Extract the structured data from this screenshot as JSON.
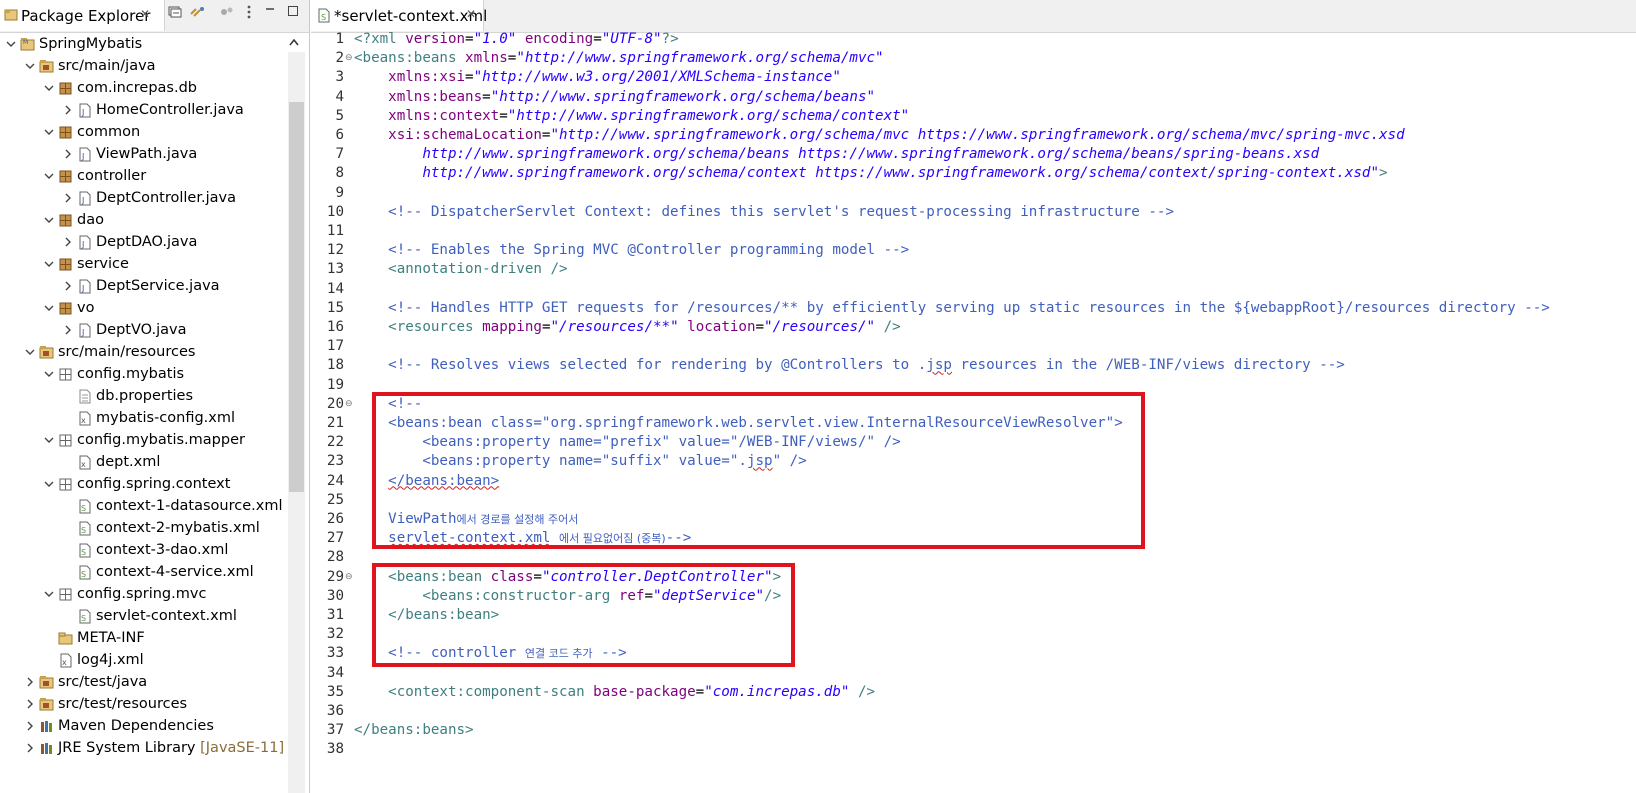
{
  "explorer": {
    "tab_title": "Package Explorer",
    "close_glyph": "✕",
    "tree": [
      {
        "label": "SpringMybatis",
        "indent": 0,
        "expanded": true,
        "icon": "project-icon",
        "deco": ""
      },
      {
        "label": "src/main/java",
        "indent": 1,
        "expanded": true,
        "icon": "source-folder-icon",
        "deco": ""
      },
      {
        "label": "com.increpas.db",
        "indent": 2,
        "expanded": true,
        "icon": "package-icon",
        "deco": ""
      },
      {
        "label": "HomeController.java",
        "indent": 3,
        "expanded": false,
        "icon": "java-file-icon",
        "deco": ""
      },
      {
        "label": "common",
        "indent": 2,
        "expanded": true,
        "icon": "package-icon",
        "deco": ""
      },
      {
        "label": "ViewPath.java",
        "indent": 3,
        "expanded": false,
        "icon": "java-file-icon",
        "deco": ""
      },
      {
        "label": "controller",
        "indent": 2,
        "expanded": true,
        "icon": "package-icon",
        "deco": ""
      },
      {
        "label": "DeptController.java",
        "indent": 3,
        "expanded": false,
        "icon": "java-file-icon",
        "deco": ""
      },
      {
        "label": "dao",
        "indent": 2,
        "expanded": true,
        "icon": "package-icon",
        "deco": ""
      },
      {
        "label": "DeptDAO.java",
        "indent": 3,
        "expanded": false,
        "icon": "java-file-icon",
        "deco": ""
      },
      {
        "label": "service",
        "indent": 2,
        "expanded": true,
        "icon": "package-icon",
        "deco": ""
      },
      {
        "label": "DeptService.java",
        "indent": 3,
        "expanded": false,
        "icon": "java-file-icon",
        "deco": ""
      },
      {
        "label": "vo",
        "indent": 2,
        "expanded": true,
        "icon": "package-icon",
        "deco": ""
      },
      {
        "label": "DeptVO.java",
        "indent": 3,
        "expanded": false,
        "icon": "java-file-icon",
        "deco": ""
      },
      {
        "label": "src/main/resources",
        "indent": 1,
        "expanded": true,
        "icon": "source-folder-icon",
        "deco": ""
      },
      {
        "label": "config.mybatis",
        "indent": 2,
        "expanded": true,
        "icon": "resource-package-icon",
        "deco": ""
      },
      {
        "label": "db.properties",
        "indent": 3,
        "expanded": null,
        "icon": "properties-file-icon",
        "deco": ""
      },
      {
        "label": "mybatis-config.xml",
        "indent": 3,
        "expanded": null,
        "icon": "xml-file-icon",
        "deco": ""
      },
      {
        "label": "config.mybatis.mapper",
        "indent": 2,
        "expanded": true,
        "icon": "resource-package-icon",
        "deco": ""
      },
      {
        "label": "dept.xml",
        "indent": 3,
        "expanded": null,
        "icon": "xml-file-icon",
        "deco": ""
      },
      {
        "label": "config.spring.context",
        "indent": 2,
        "expanded": true,
        "icon": "resource-package-icon",
        "deco": ""
      },
      {
        "label": "context-1-datasource.xml",
        "indent": 3,
        "expanded": null,
        "icon": "spring-xml-icon",
        "deco": ""
      },
      {
        "label": "context-2-mybatis.xml",
        "indent": 3,
        "expanded": null,
        "icon": "spring-xml-icon",
        "deco": ""
      },
      {
        "label": "context-3-dao.xml",
        "indent": 3,
        "expanded": null,
        "icon": "spring-xml-icon",
        "deco": ""
      },
      {
        "label": "context-4-service.xml",
        "indent": 3,
        "expanded": null,
        "icon": "spring-xml-icon",
        "deco": ""
      },
      {
        "label": "config.spring.mvc",
        "indent": 2,
        "expanded": true,
        "icon": "resource-package-icon",
        "deco": ""
      },
      {
        "label": "servlet-context.xml",
        "indent": 3,
        "expanded": null,
        "icon": "spring-xml-icon",
        "deco": "",
        "selected": true
      },
      {
        "label": "META-INF",
        "indent": 2,
        "expanded": null,
        "icon": "folder-icon",
        "deco": ""
      },
      {
        "label": "log4j.xml",
        "indent": 2,
        "expanded": null,
        "icon": "xml-file-icon",
        "deco": ""
      },
      {
        "label": "src/test/java",
        "indent": 1,
        "expanded": false,
        "icon": "source-folder-icon",
        "deco": ""
      },
      {
        "label": "src/test/resources",
        "indent": 1,
        "expanded": false,
        "icon": "source-folder-icon",
        "deco": ""
      },
      {
        "label": "Maven Dependencies",
        "indent": 1,
        "expanded": false,
        "icon": "library-icon",
        "deco": ""
      },
      {
        "label": "JRE System Library",
        "indent": 1,
        "expanded": false,
        "icon": "library-icon",
        "deco": "[JavaSE-11]"
      }
    ]
  },
  "editor": {
    "tab_title": "*servlet-context.xml",
    "close_glyph": "✕",
    "lines": [
      {
        "n": "1",
        "fold": false,
        "segs": [
          [
            "tag",
            "<?xml "
          ],
          [
            "attr",
            "version"
          ],
          [
            "txt",
            "="
          ],
          [
            "val",
            "\"1.0\""
          ],
          [
            "txt",
            " "
          ],
          [
            "attr",
            "encoding"
          ],
          [
            "txt",
            "="
          ],
          [
            "val",
            "\"UTF-8\""
          ],
          [
            "tag",
            "?>"
          ]
        ]
      },
      {
        "n": "2",
        "fold": true,
        "segs": [
          [
            "tag",
            "<beans:beans "
          ],
          [
            "attr",
            "xmlns"
          ],
          [
            "txt",
            "="
          ],
          [
            "val",
            "\"http://www.springframework.org/schema/mvc\""
          ]
        ]
      },
      {
        "n": "3",
        "fold": false,
        "segs": [
          [
            "txt",
            "    "
          ],
          [
            "attr",
            "xmlns:xsi"
          ],
          [
            "txt",
            "="
          ],
          [
            "val",
            "\"http://www.w3.org/2001/XMLSchema-instance\""
          ]
        ]
      },
      {
        "n": "4",
        "fold": false,
        "segs": [
          [
            "txt",
            "    "
          ],
          [
            "attr",
            "xmlns:beans"
          ],
          [
            "txt",
            "="
          ],
          [
            "val",
            "\"http://www.springframework.org/schema/beans\""
          ]
        ]
      },
      {
        "n": "5",
        "fold": false,
        "segs": [
          [
            "txt",
            "    "
          ],
          [
            "attr",
            "xmlns:context"
          ],
          [
            "txt",
            "="
          ],
          [
            "val",
            "\"http://www.springframework.org/schema/context\""
          ]
        ]
      },
      {
        "n": "6",
        "fold": false,
        "segs": [
          [
            "txt",
            "    "
          ],
          [
            "attr",
            "xsi:schemaLocation"
          ],
          [
            "txt",
            "="
          ],
          [
            "val",
            "\"http://www.springframework.org/schema/mvc https://www.springframework.org/schema/mvc/spring-mvc.xsd"
          ]
        ]
      },
      {
        "n": "7",
        "fold": false,
        "segs": [
          [
            "val",
            "        http://www.springframework.org/schema/beans https://www.springframework.org/schema/beans/spring-beans.xsd"
          ]
        ]
      },
      {
        "n": "8",
        "fold": false,
        "segs": [
          [
            "val",
            "        http://www.springframework.org/schema/context https://www.springframework.org/schema/context/spring-context.xsd\""
          ],
          [
            "tag",
            ">"
          ]
        ]
      },
      {
        "n": "9",
        "fold": false,
        "segs": []
      },
      {
        "n": "10",
        "fold": false,
        "segs": [
          [
            "txt",
            "    "
          ],
          [
            "cmt",
            "<!-- DispatcherServlet Context: defines this servlet's request-processing infrastructure -->"
          ]
        ]
      },
      {
        "n": "11",
        "fold": false,
        "segs": []
      },
      {
        "n": "12",
        "fold": false,
        "segs": [
          [
            "txt",
            "    "
          ],
          [
            "cmt",
            "<!-- Enables the Spring MVC @Controller programming model -->"
          ]
        ]
      },
      {
        "n": "13",
        "fold": false,
        "segs": [
          [
            "txt",
            "    "
          ],
          [
            "tag",
            "<annotation-driven />"
          ]
        ]
      },
      {
        "n": "14",
        "fold": false,
        "segs": []
      },
      {
        "n": "15",
        "fold": false,
        "segs": [
          [
            "txt",
            "    "
          ],
          [
            "cmt",
            "<!-- Handles HTTP GET requests for /resources/** by efficiently serving up static resources in the ${webappRoot}/resources directory -->"
          ]
        ]
      },
      {
        "n": "16",
        "fold": false,
        "segs": [
          [
            "txt",
            "    "
          ],
          [
            "tag",
            "<resources "
          ],
          [
            "attr",
            "mapping"
          ],
          [
            "txt",
            "="
          ],
          [
            "val",
            "\"/resources/**\""
          ],
          [
            "txt",
            " "
          ],
          [
            "attr",
            "location"
          ],
          [
            "txt",
            "="
          ],
          [
            "val",
            "\"/resources/\""
          ],
          [
            "tag",
            " />"
          ]
        ]
      },
      {
        "n": "17",
        "fold": false,
        "segs": []
      },
      {
        "n": "18",
        "fold": false,
        "segs": [
          [
            "txt",
            "    "
          ],
          [
            "cmt",
            "<!-- Resolves views selected for rendering by @Controllers to ."
          ],
          [
            "cmt squig",
            "jsp"
          ],
          [
            "cmt",
            " resources in the /WEB-INF/views directory -->"
          ]
        ]
      },
      {
        "n": "19",
        "fold": false,
        "segs": []
      },
      {
        "n": "20",
        "fold": true,
        "segs": [
          [
            "txt",
            "    "
          ],
          [
            "cmt",
            "<!--"
          ]
        ]
      },
      {
        "n": "21",
        "fold": false,
        "segs": [
          [
            "txt",
            "    "
          ],
          [
            "cmt",
            "<beans:bean class=\"org.springframework.web.servlet.view.InternalResourceViewResolver\">"
          ]
        ]
      },
      {
        "n": "22",
        "fold": false,
        "segs": [
          [
            "txt",
            "        "
          ],
          [
            "cmt",
            "<beans:property name=\"prefix\" value=\"/WEB-INF/views/\" />"
          ]
        ]
      },
      {
        "n": "23",
        "fold": false,
        "segs": [
          [
            "txt",
            "        "
          ],
          [
            "cmt",
            "<beans:property name=\"suffix\" value=\"."
          ],
          [
            "cmt squig",
            "jsp"
          ],
          [
            "cmt",
            "\" />"
          ]
        ]
      },
      {
        "n": "24",
        "fold": false,
        "segs": [
          [
            "txt",
            "    "
          ],
          [
            "cmt squig",
            "</beans:bean>"
          ]
        ]
      },
      {
        "n": "25",
        "fold": false,
        "segs": []
      },
      {
        "n": "26",
        "fold": false,
        "segs": [
          [
            "txt",
            "    "
          ],
          [
            "cmt",
            "ViewPath"
          ],
          [
            "cmt kor",
            "에서 경로를 설정해 주어서"
          ]
        ]
      },
      {
        "n": "27",
        "fold": false,
        "segs": [
          [
            "txt",
            "    "
          ],
          [
            "cmt squig",
            "servlet-context.xml"
          ],
          [
            "cmt",
            " "
          ],
          [
            "cmt kor",
            "에서 필요없어짐 (중복)"
          ],
          [
            "cmt",
            "-->"
          ]
        ]
      },
      {
        "n": "28",
        "fold": false,
        "segs": []
      },
      {
        "n": "29",
        "fold": true,
        "segs": [
          [
            "txt",
            "    "
          ],
          [
            "tag",
            "<beans:bean "
          ],
          [
            "attr",
            "class"
          ],
          [
            "txt",
            "="
          ],
          [
            "val",
            "\"controller.DeptController\""
          ],
          [
            "tag",
            ">"
          ]
        ]
      },
      {
        "n": "30",
        "fold": false,
        "segs": [
          [
            "txt",
            "        "
          ],
          [
            "tag",
            "<beans:constructor-arg "
          ],
          [
            "attr",
            "ref"
          ],
          [
            "txt",
            "="
          ],
          [
            "val",
            "\"deptService\""
          ],
          [
            "tag",
            "/>"
          ]
        ]
      },
      {
        "n": "31",
        "fold": false,
        "segs": [
          [
            "txt",
            "    "
          ],
          [
            "tag",
            "</beans:bean>"
          ]
        ]
      },
      {
        "n": "32",
        "fold": false,
        "segs": []
      },
      {
        "n": "33",
        "fold": false,
        "segs": [
          [
            "txt",
            "    "
          ],
          [
            "cmt",
            "<!-- controller "
          ],
          [
            "cmt kor",
            "연결 코드 추가"
          ],
          [
            "cmt",
            " -->"
          ]
        ]
      },
      {
        "n": "34",
        "fold": false,
        "segs": []
      },
      {
        "n": "35",
        "fold": false,
        "segs": [
          [
            "txt",
            "    "
          ],
          [
            "tag",
            "<context:component-scan "
          ],
          [
            "attr",
            "base-package"
          ],
          [
            "txt",
            "="
          ],
          [
            "val",
            "\"com.increpas.db\""
          ],
          [
            "tag",
            " />"
          ]
        ]
      },
      {
        "n": "36",
        "fold": false,
        "segs": []
      },
      {
        "n": "37",
        "fold": false,
        "segs": [
          [
            "tag",
            "</beans:beans>"
          ]
        ]
      },
      {
        "n": "38",
        "fold": false,
        "segs": []
      }
    ]
  },
  "highlight_color": "#e0141e"
}
